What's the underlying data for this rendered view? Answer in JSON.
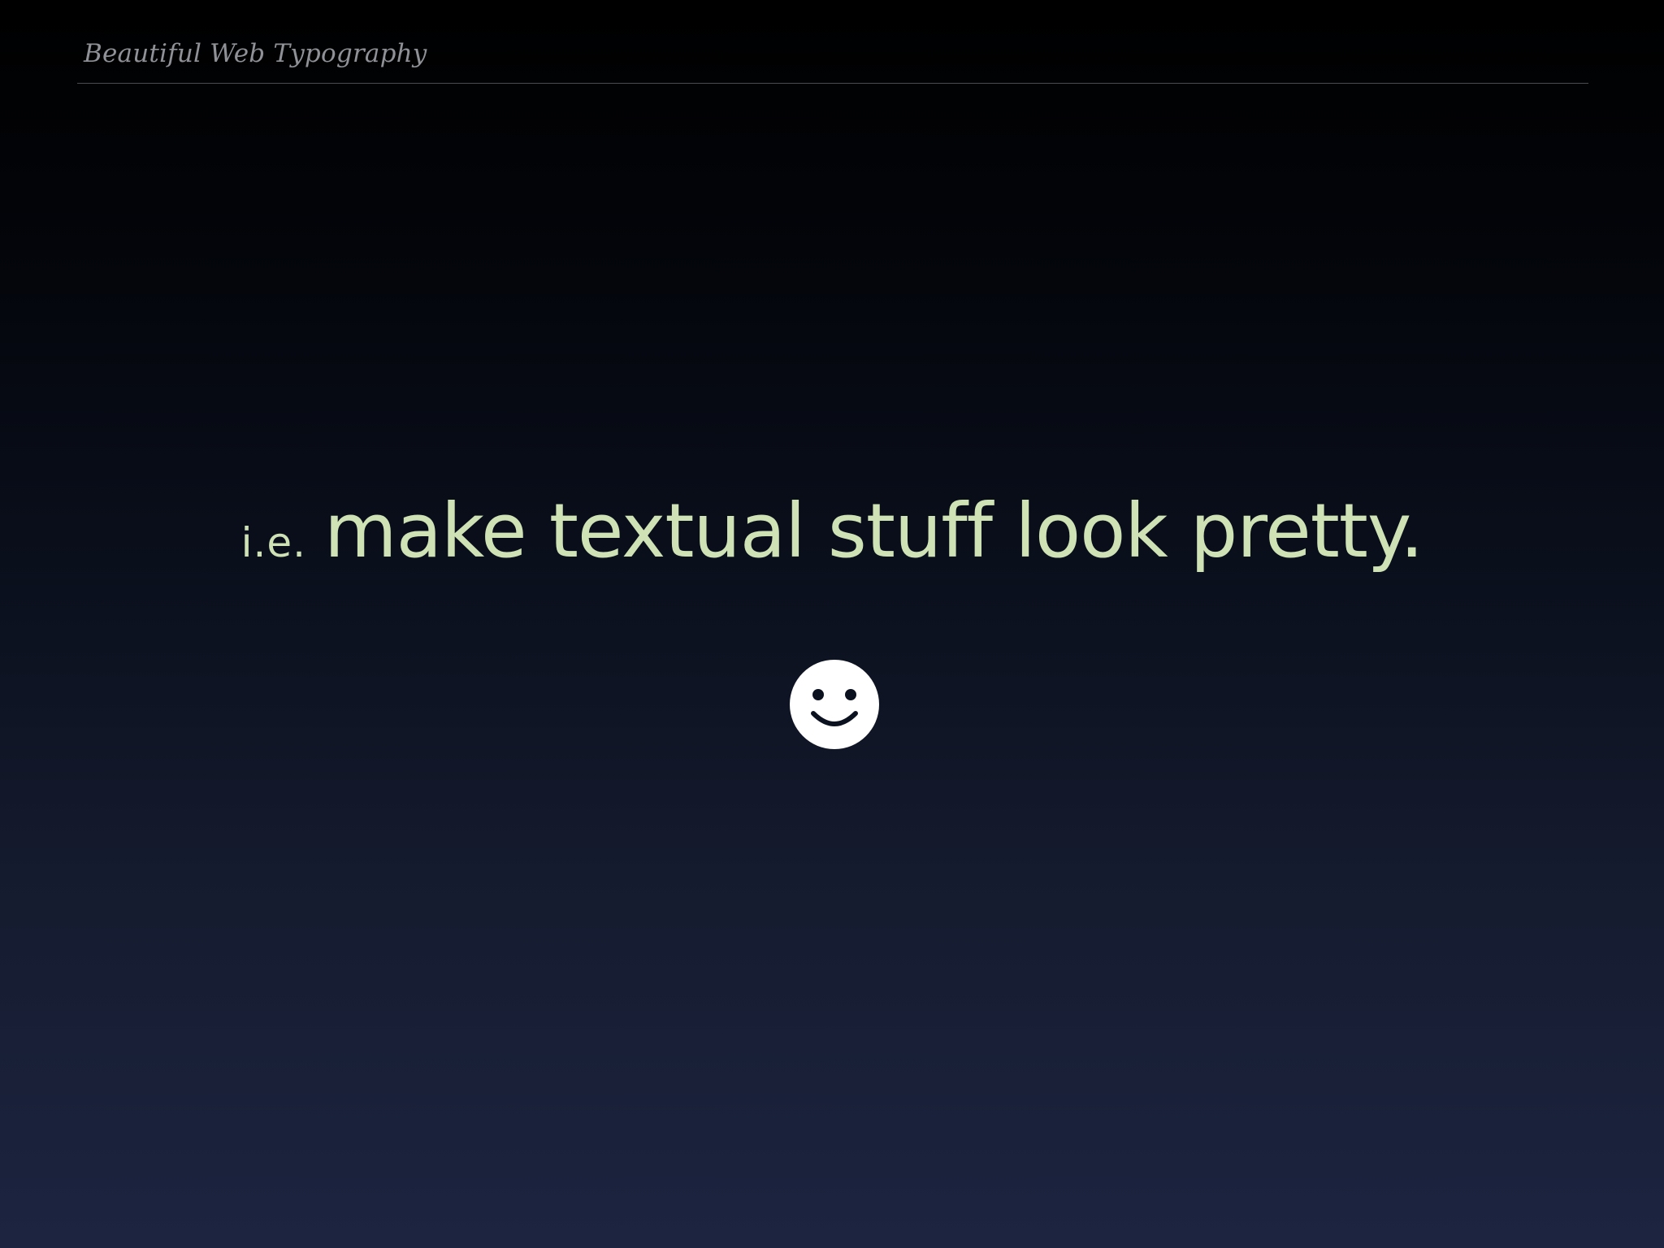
{
  "header": {
    "title": "Beautiful Web Typography"
  },
  "headline": {
    "prefix": "i.e.",
    "text": "make textual stuff look pretty."
  },
  "icons": {
    "smiley": "smiley-face-icon"
  },
  "colors": {
    "headline": "#cfe2b6",
    "header_text": "#8f9197",
    "background_top": "#000000",
    "background_bottom": "#1c2440",
    "icon": "#ffffff"
  }
}
